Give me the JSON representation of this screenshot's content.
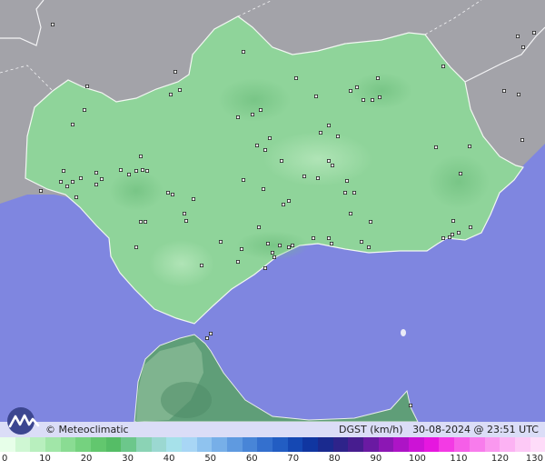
{
  "credit": "© Meteoclimatic",
  "info": {
    "variable": "DGST (km/h)",
    "timestamp": "30-08-2024 @ 23:51 UTC"
  },
  "colors": {
    "sea": "#7f86e0",
    "land_outside": "#a3a3a9",
    "region": "#8fd49a",
    "africa": "#5f9e78",
    "logo": "#3c4690"
  },
  "legend": {
    "ticks": [
      "0",
      "10",
      "20",
      "30",
      "40",
      "50",
      "60",
      "70",
      "80",
      "90",
      "100",
      "110",
      "120",
      "130"
    ],
    "colors": [
      "#e7ffe9",
      "#cff7d3",
      "#b8efbe",
      "#a1e6a8",
      "#8adc93",
      "#75d27f",
      "#62c76e",
      "#55bd66",
      "#6cc78b",
      "#8bd3b5",
      "#9bd8d1",
      "#a6e1ea",
      "#a8d6f5",
      "#8fc3ef",
      "#77afe8",
      "#5f9ae0",
      "#4885d7",
      "#3470ce",
      "#225dc3",
      "#1548b3",
      "#1036a1",
      "#1a2a8f",
      "#2e238a",
      "#471d8f",
      "#6a1aa2",
      "#8c17b4",
      "#ad14c6",
      "#cc13d6",
      "#e617df",
      "#f33ae4",
      "#f65ee8",
      "#f87cec",
      "#fa98ef",
      "#fcb2f3",
      "#fdc9f6",
      "#fedcf9"
    ]
  }
}
